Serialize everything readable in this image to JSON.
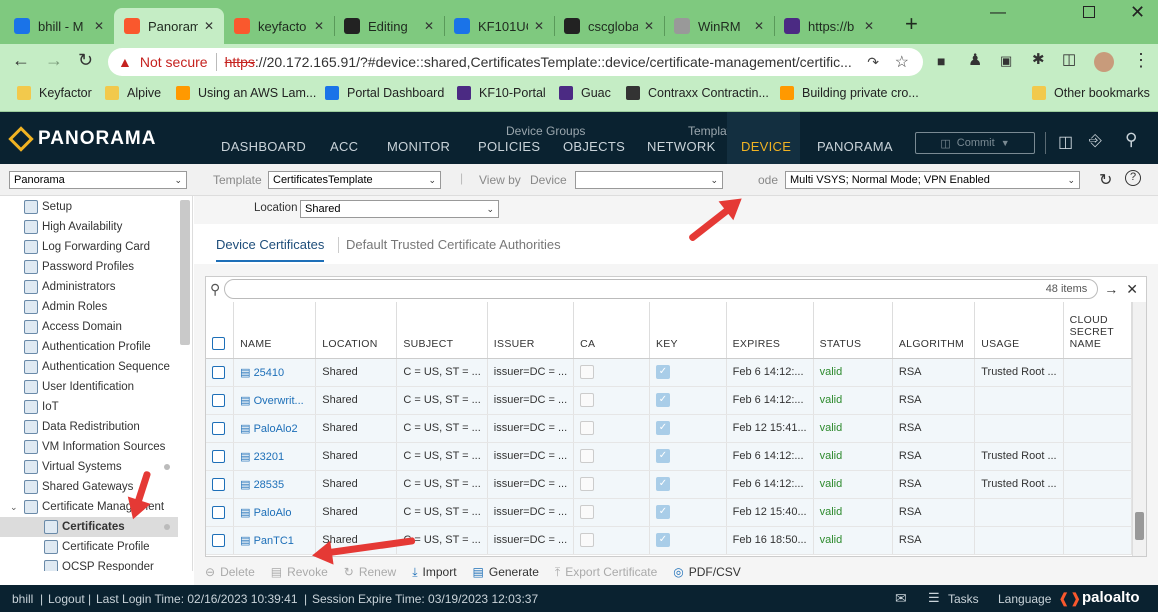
{
  "browser": {
    "tabs": [
      {
        "label": "bhill - M",
        "fav_color": "#1a73e8"
      },
      {
        "label": "Panoram",
        "fav_color": "#fa582d",
        "active": true
      },
      {
        "label": "keyfacto",
        "fav_color": "#fa582d"
      },
      {
        "label": "Editing",
        "fav_color": "#222"
      },
      {
        "label": "KF101UC",
        "fav_color": "#1a73e8"
      },
      {
        "label": "cscgloba",
        "fav_color": "#222"
      },
      {
        "label": "WinRM",
        "fav_color": "#999"
      },
      {
        "label": "https://b",
        "fav_color": "#4b2a83"
      }
    ],
    "new_tab": "+",
    "not_secure": "Not secure",
    "url_scheme": "https",
    "url_rest": "://20.172.165.91/?#device::shared,CertificatesTemplate::device/certificate-management/certific...",
    "bookmarks": [
      {
        "label": "Keyfactor",
        "color": "#f2c94c"
      },
      {
        "label": "Alpive",
        "color": "#f2c94c"
      },
      {
        "label": "Using an AWS Lam...",
        "color": "#ff9900"
      },
      {
        "label": "Portal Dashboard",
        "color": "#1a73e8"
      },
      {
        "label": "KF10-Portal",
        "color": "#4b2a83"
      },
      {
        "label": "Guac",
        "color": "#4b2a83"
      },
      {
        "label": "Contraxx Contractin...",
        "color": "#333"
      },
      {
        "label": "Building private cro...",
        "color": "#ff9900"
      }
    ],
    "other_bookmarks": "Other bookmarks"
  },
  "header": {
    "logo": "PANORAMA",
    "nav": [
      "DASHBOARD",
      "ACC",
      "MONITOR",
      "POLICIES",
      "OBJECTS",
      "NETWORK",
      "DEVICE",
      "PANORAMA"
    ],
    "group_device_groups": "Device Groups",
    "group_templates": "Templates",
    "commit": "Commit"
  },
  "context": {
    "panorama_select": "Panorama",
    "template_label": "Template",
    "template_value": "CertificatesTemplate",
    "viewby_label": "View by",
    "device_label": "Device",
    "device_value": "",
    "mode_label": "ode",
    "mode_value": "Multi VSYS; Normal Mode; VPN Enabled"
  },
  "sidebar": {
    "items": [
      "Setup",
      "High Availability",
      "Log Forwarding Card",
      "Password Profiles",
      "Administrators",
      "Admin Roles",
      "Access Domain",
      "Authentication Profile",
      "Authentication Sequence",
      "User Identification",
      "IoT",
      "Data Redistribution",
      "VM Information Sources",
      "Virtual Systems",
      "Shared Gateways",
      "Certificate Management",
      "Certificates",
      "Certificate Profile",
      "OCSP Responder"
    ]
  },
  "main": {
    "location_label": "Location",
    "location_value": "Shared",
    "tabs": [
      "Device Certificates",
      "Default Trusted Certificate Authorities"
    ],
    "items_count": "48 items",
    "columns": [
      "NAME",
      "LOCATION",
      "SUBJECT",
      "ISSUER",
      "CA",
      "KEY",
      "EXPIRES",
      "STATUS",
      "ALGORITHM",
      "USAGE",
      "CLOUD SECRET NAME"
    ],
    "rows": [
      {
        "name": "25410",
        "location": "Shared",
        "subject": "C = US, ST = ...",
        "issuer": "issuer=DC = ...",
        "expires": "Feb 6 14:12:...",
        "status": "valid",
        "algorithm": "RSA",
        "usage": "Trusted Root ..."
      },
      {
        "name": "Overwrit...",
        "location": "Shared",
        "subject": "C = US, ST = ...",
        "issuer": "issuer=DC = ...",
        "expires": "Feb 6 14:12:...",
        "status": "valid",
        "algorithm": "RSA",
        "usage": ""
      },
      {
        "name": "PaloAlo2",
        "location": "Shared",
        "subject": "C = US, ST = ...",
        "issuer": "issuer=DC = ...",
        "expires": "Feb 12 15:41...",
        "status": "valid",
        "algorithm": "RSA",
        "usage": ""
      },
      {
        "name": "23201",
        "location": "Shared",
        "subject": "C = US, ST = ...",
        "issuer": "issuer=DC = ...",
        "expires": "Feb 6 14:12:...",
        "status": "valid",
        "algorithm": "RSA",
        "usage": "Trusted Root ..."
      },
      {
        "name": "28535",
        "location": "Shared",
        "subject": "C = US, ST = ...",
        "issuer": "issuer=DC = ...",
        "expires": "Feb 6 14:12:...",
        "status": "valid",
        "algorithm": "RSA",
        "usage": "Trusted Root ..."
      },
      {
        "name": "PaloAlo",
        "location": "Shared",
        "subject": "C = US, ST = ...",
        "issuer": "issuer=DC = ...",
        "expires": "Feb 12 15:40...",
        "status": "valid",
        "algorithm": "RSA",
        "usage": ""
      },
      {
        "name": "PanTC1",
        "location": "Shared",
        "subject": "C = US, ST = ...",
        "issuer": "issuer=DC = ...",
        "expires": "Feb 16 18:50...",
        "status": "valid",
        "algorithm": "RSA",
        "usage": ""
      }
    ],
    "actions": [
      "Delete",
      "Revoke",
      "Renew",
      "Import",
      "Generate",
      "Export Certificate",
      "PDF/CSV"
    ]
  },
  "status_bar": {
    "user": "bhill",
    "logout": "Logout",
    "last_login": "Last Login Time: 02/16/2023 10:39:41",
    "session_expire": "Session Expire Time: 03/19/2023 12:03:37",
    "tasks": "Tasks",
    "language": "Language",
    "brand": "paloalto"
  }
}
